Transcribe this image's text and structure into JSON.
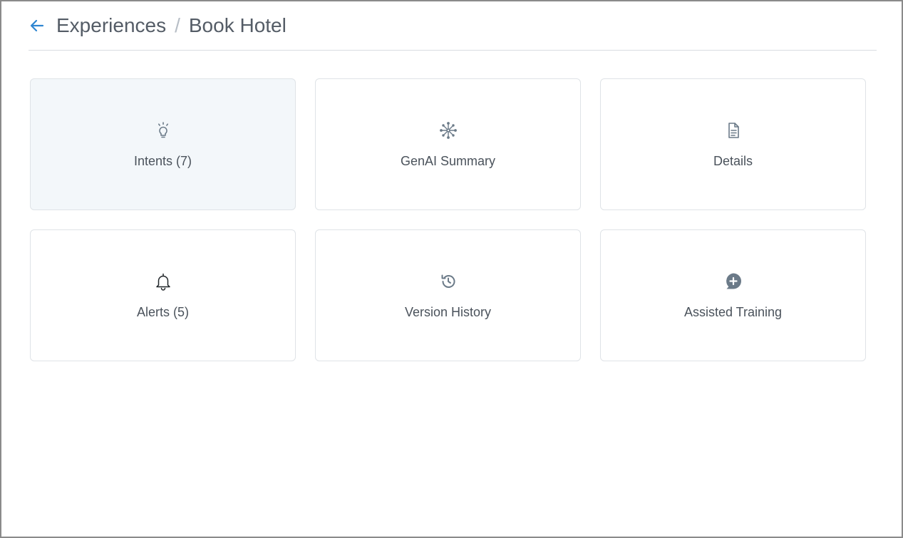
{
  "breadcrumb": {
    "parent": "Experiences",
    "separator": "/",
    "current": "Book Hotel"
  },
  "icons": {
    "back": "arrow-left-icon"
  },
  "cards": [
    {
      "label": "Intents (7)",
      "icon": "lightbulb-icon",
      "selected": true
    },
    {
      "label": "GenAI Summary",
      "icon": "network-icon",
      "selected": false
    },
    {
      "label": "Details",
      "icon": "document-icon",
      "selected": false
    },
    {
      "label": "Alerts (5)",
      "icon": "bell-icon",
      "selected": false
    },
    {
      "label": "Version History",
      "icon": "history-icon",
      "selected": false
    },
    {
      "label": "Assisted Training",
      "icon": "chat-plus-icon",
      "selected": false
    }
  ],
  "colors": {
    "accent": "#2f86d1",
    "icon": "#6b7a88",
    "selected_card_bg": "#f3f7fa",
    "card_border": "#dfe3e7"
  }
}
